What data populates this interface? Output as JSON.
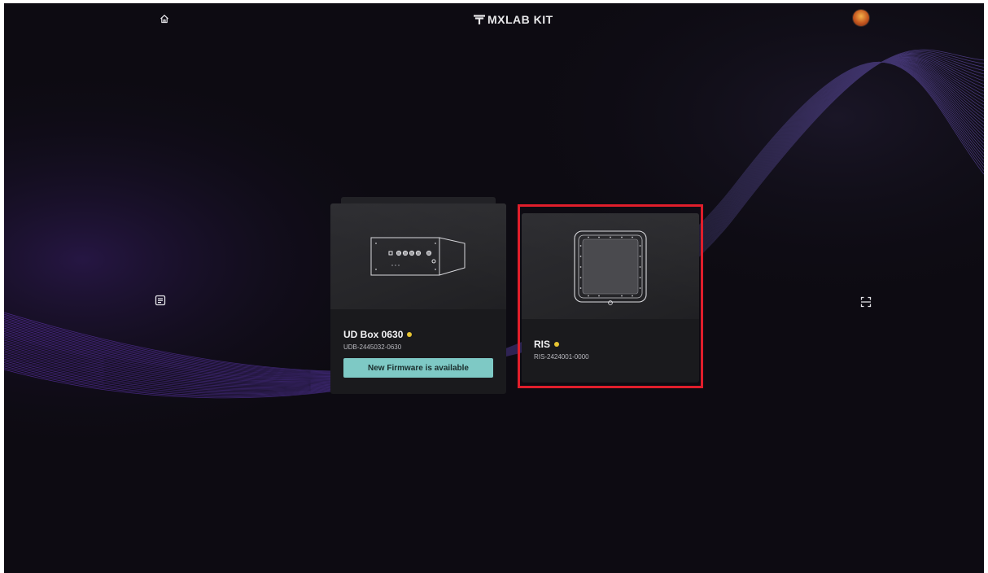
{
  "app": {
    "title": "MXLAB KIT",
    "logo_icon": "mx-logo-icon"
  },
  "topbar": {
    "home_icon": "home-icon",
    "avatar_icon": "user-avatar"
  },
  "sidebar": {
    "left_icon": "notes-icon",
    "right_icon": "scan-icon"
  },
  "devices": [
    {
      "name": "UD Box 0630",
      "serial": "UDB-2445032-0630",
      "status_color": "#e8c532",
      "image": "ud-box-illustration",
      "action_label": "New Firmware is available",
      "action_color": "#7ec9c5"
    },
    {
      "name": "RIS",
      "serial": "RIS-2424001-0000",
      "status_color": "#e8c532",
      "image": "ris-panel-illustration",
      "selected": true
    }
  ],
  "colors": {
    "background": "#0d0b12",
    "card": "#1a1a1d",
    "selection": "#e01e2b",
    "accent_wave": "#6a3cc8"
  }
}
